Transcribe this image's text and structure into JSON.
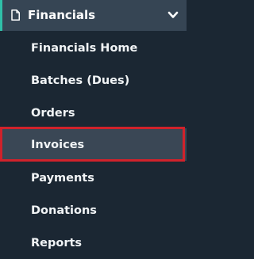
{
  "menu": {
    "header": {
      "icon": "document-icon",
      "title": "Financials",
      "chevron_icon": "chevron-down-icon"
    },
    "items": [
      {
        "label": "Financials Home"
      },
      {
        "label": "Batches (Dues)"
      },
      {
        "label": "Orders"
      },
      {
        "label": "Invoices",
        "active": true
      },
      {
        "label": "Payments"
      },
      {
        "label": "Donations"
      },
      {
        "label": "Reports"
      }
    ]
  },
  "colors": {
    "background": "#1b2733",
    "header_background": "#364554",
    "header_accent": "#2fbfa8",
    "active_background": "#3a4755",
    "highlight_border": "#d0222b",
    "text": "#ffffff"
  }
}
